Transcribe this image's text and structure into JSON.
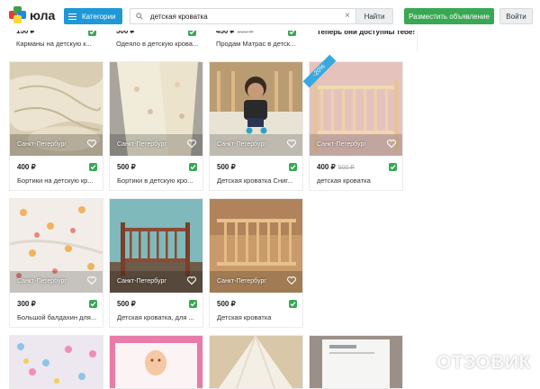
{
  "header": {
    "logo_text": "юла",
    "categories_label": "Категории",
    "search_value": "детская кроватка",
    "search_button": "Найти",
    "post_button": "Разместить объявление",
    "login_button": "Войти"
  },
  "top_row": [
    {
      "price": "150 ₽",
      "title": "Карманы на детскую к..."
    },
    {
      "price": "500 ₽",
      "title": "Одеяло в детскую крова..."
    },
    {
      "price": "450 ₽",
      "old_price": "500 ₽",
      "title": "Продам Матрас в детск..."
    },
    {
      "promo": "Теперь они доступны тебе!"
    }
  ],
  "cards": [
    {
      "city": "Санкт-Петербург",
      "price": "400 ₽",
      "title": "Бортики на детскую кр..."
    },
    {
      "city": "Санкт-Петербург",
      "price": "500 ₽",
      "title": "Бортики в детскую кро..."
    },
    {
      "city": "Санкт-Петербург",
      "price": "500 ₽",
      "title": "Детская кроватка Сниг..."
    },
    {
      "city": "Санкт-Петербург",
      "price": "400 ₽",
      "old_price": "500 ₽",
      "title": "детская кроватка",
      "badge": "-20%"
    },
    {
      "city": "Санкт-Петербург",
      "price": "300 ₽",
      "title": "Большой балдахин для..."
    },
    {
      "city": "Санкт-Петербург",
      "price": "500 ₽",
      "title": "Детская кроватка, для ..."
    },
    {
      "city": "Санкт-Петербург",
      "price": "500 ₽",
      "title": "Детская кроватка"
    }
  ],
  "watermark": "ОТЗОВИК",
  "colors": {
    "accent_blue": "#1e98d7",
    "accent_green": "#38a854",
    "badge_blue": "#3aa8e0"
  }
}
